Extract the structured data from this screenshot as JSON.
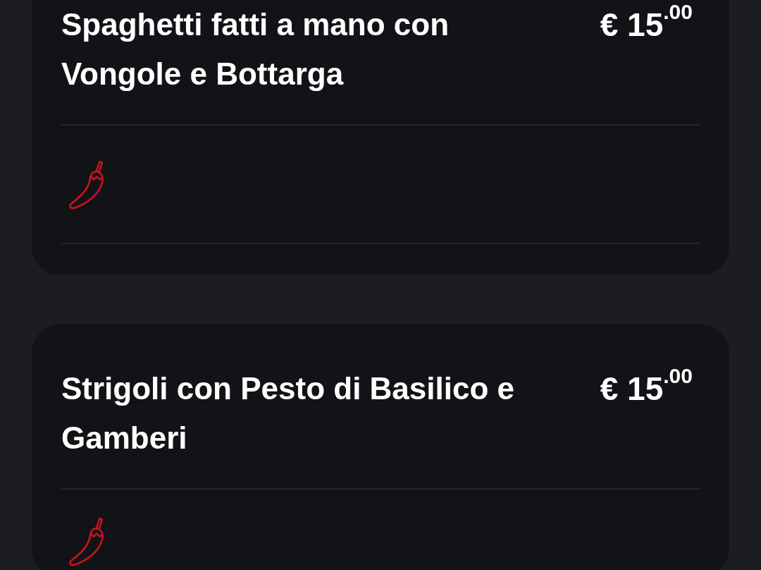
{
  "menu_items": [
    {
      "title": "Spaghetti fatti a mano con Vongole e Bottarga",
      "price": "€ 15$^{.00}$",
      "spicy": true
    },
    {
      "title": "Strigoli con Pesto di Basilico e Gamberi",
      "price": "€ 15$^{.00}$",
      "spicy": true
    }
  ]
}
